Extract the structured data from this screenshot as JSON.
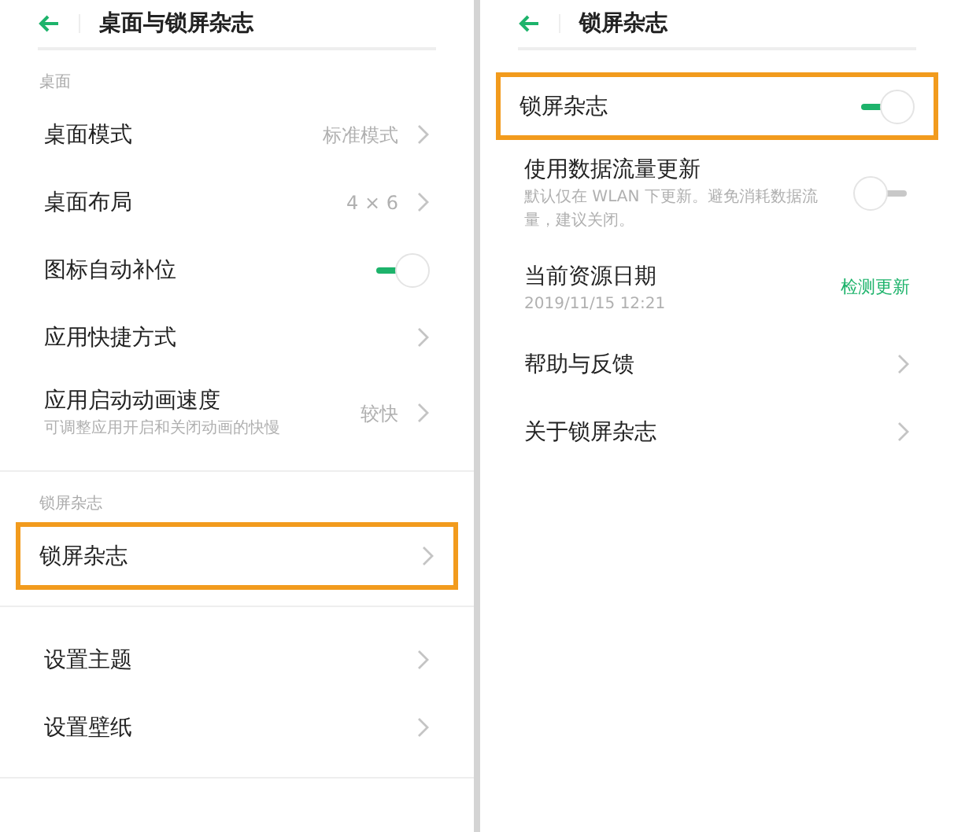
{
  "panels": [
    {
      "title": "桌面与锁屏杂志",
      "sections": [
        {
          "label": "桌面",
          "items": [
            {
              "kind": "nav",
              "label": "桌面模式",
              "value": "标准模式",
              "highlighted": false
            },
            {
              "kind": "nav",
              "label": "桌面布局",
              "value": "4 × 6",
              "highlighted": false
            },
            {
              "kind": "toggle",
              "label": "图标自动补位",
              "on": true,
              "highlighted": false
            },
            {
              "kind": "nav",
              "label": "应用快捷方式",
              "highlighted": false
            },
            {
              "kind": "nav",
              "label": "应用启动动画速度",
              "subtitle": "可调整应用开启和关闭动画的快慢",
              "value": "较快",
              "highlighted": false
            }
          ]
        },
        {
          "label": "锁屏杂志",
          "items": [
            {
              "kind": "nav",
              "label": "锁屏杂志",
              "highlighted": true
            }
          ]
        },
        {
          "items": [
            {
              "kind": "nav",
              "label": "设置主题",
              "highlighted": false
            },
            {
              "kind": "nav",
              "label": "设置壁纸",
              "highlighted": false
            }
          ]
        }
      ]
    },
    {
      "title": "锁屏杂志",
      "sections": [
        {
          "items": [
            {
              "kind": "toggle",
              "label": "锁屏杂志",
              "on": true,
              "highlighted": true
            },
            {
              "kind": "toggle",
              "label": "使用数据流量更新",
              "subtitle": "默认仅在 WLAN 下更新。避免消耗数据流量，建议关闭。",
              "on": false,
              "highlighted": false
            },
            {
              "kind": "link",
              "label": "当前资源日期",
              "subtitle": "2019/11/15 12:21",
              "action": "检测更新",
              "highlighted": false
            },
            {
              "kind": "nav",
              "label": "帮助与反馈",
              "highlighted": false
            },
            {
              "kind": "nav",
              "label": "关于锁屏杂志",
              "highlighted": false
            }
          ]
        }
      ]
    }
  ]
}
